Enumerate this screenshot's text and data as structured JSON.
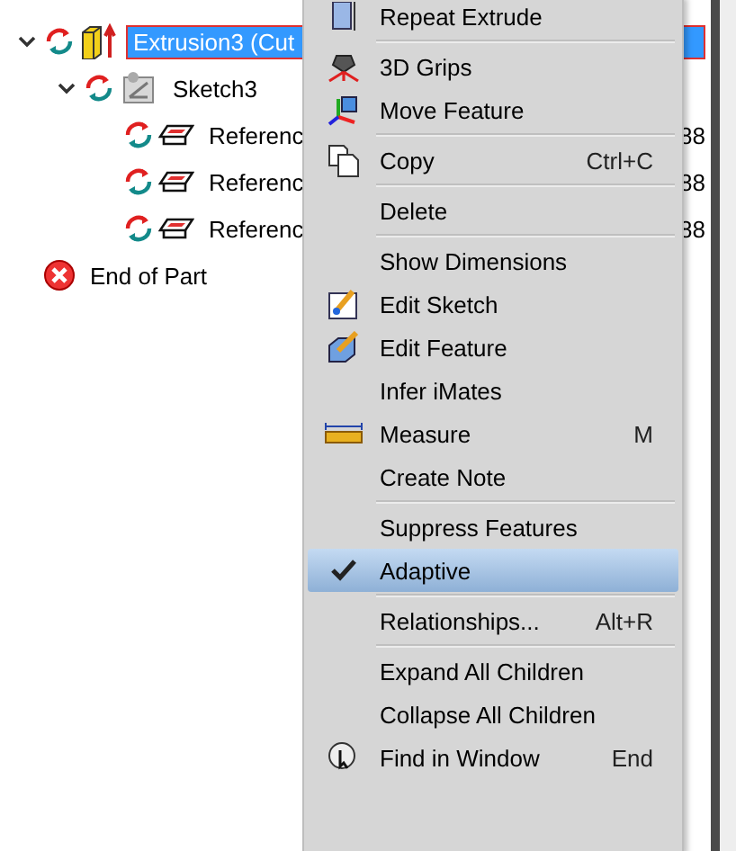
{
  "tree": {
    "items": [
      {
        "kind": "extrusion",
        "label": "Extrusion3 (Cut",
        "expanded": true,
        "selected": true,
        "children": [
          {
            "kind": "sketch",
            "label": "Sketch3",
            "expanded": true,
            "selected": false,
            "children": [
              {
                "kind": "reference",
                "label": "Referenc",
                "tail": "88",
                "selected": false
              },
              {
                "kind": "reference",
                "label": "Referenc",
                "tail": "88",
                "selected": false
              },
              {
                "kind": "reference",
                "label": "Referenc",
                "tail": "88",
                "selected": false
              }
            ]
          }
        ]
      },
      {
        "kind": "end",
        "label": "End of Part",
        "selected": false
      }
    ]
  },
  "context_menu": {
    "items": [
      {
        "kind": "extrude",
        "label": "Repeat Extrude",
        "checked": false,
        "selected": false
      },
      {
        "kind": "separator"
      },
      {
        "kind": "grips",
        "label": "3D Grips",
        "checked": false,
        "selected": false
      },
      {
        "kind": "move",
        "label": "Move Feature",
        "checked": false,
        "selected": false
      },
      {
        "kind": "separator"
      },
      {
        "kind": "copy",
        "label": "Copy",
        "shortcut": "Ctrl+C",
        "checked": false,
        "selected": false
      },
      {
        "kind": "separator"
      },
      {
        "kind": "plain",
        "label": "Delete",
        "checked": false,
        "selected": false
      },
      {
        "kind": "separator"
      },
      {
        "kind": "plain",
        "label": "Show Dimensions",
        "checked": false,
        "selected": false
      },
      {
        "kind": "editsketch",
        "label": "Edit Sketch",
        "checked": false,
        "selected": false
      },
      {
        "kind": "editfeature",
        "label": "Edit Feature",
        "checked": false,
        "selected": false
      },
      {
        "kind": "plain",
        "label": "Infer iMates",
        "checked": false,
        "selected": false
      },
      {
        "kind": "measure",
        "label": "Measure",
        "shortcut": "M",
        "checked": false,
        "selected": false
      },
      {
        "kind": "plain",
        "label": "Create Note",
        "checked": false,
        "selected": false
      },
      {
        "kind": "separator"
      },
      {
        "kind": "plain",
        "label": "Suppress Features",
        "checked": false,
        "selected": false
      },
      {
        "kind": "plain",
        "label": "Adaptive",
        "checked": true,
        "selected": true
      },
      {
        "kind": "separator"
      },
      {
        "kind": "plain",
        "label": "Relationships...",
        "shortcut": "Alt+R",
        "checked": false,
        "selected": false
      },
      {
        "kind": "separator"
      },
      {
        "kind": "plain",
        "label": "Expand All Children",
        "checked": false,
        "selected": false
      },
      {
        "kind": "plain",
        "label": "Collapse All Children",
        "checked": false,
        "selected": false
      },
      {
        "kind": "find",
        "label": "Find in Window",
        "shortcut": "End",
        "checked": false,
        "selected": false
      }
    ]
  }
}
